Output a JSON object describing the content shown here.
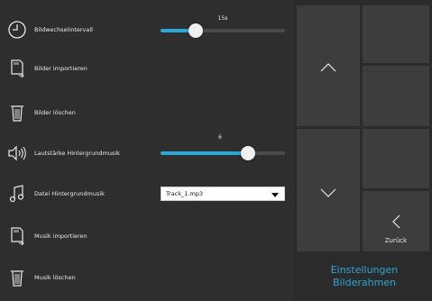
{
  "settings": {
    "slideshow_interval": {
      "label": "Bildwechselintervall",
      "value_text": "15s",
      "level": 0.28
    },
    "import_images": {
      "label": "Bilder importieren"
    },
    "delete_images": {
      "label": "Bilder löschen"
    },
    "music_volume": {
      "label": "Lautstärke Hintergrundmusik",
      "value_text": "6",
      "level": 0.7
    },
    "music_file": {
      "label": "Datei Hintergrundmusik",
      "selected": "Track_1.mp3"
    },
    "import_music": {
      "label": "Musik importieren"
    },
    "delete_music": {
      "label": "Musik löschen"
    }
  },
  "nav": {
    "back_label": "Zurück",
    "title_line1": "Einstellungen",
    "title_line2": "Bilderahmen"
  },
  "colors": {
    "accent": "#29a9d8",
    "panel": "#2e2e2e",
    "button": "#3d3d3d"
  },
  "icons": [
    "clock-icon",
    "import-card-icon",
    "trash-icon",
    "speaker-icon",
    "music-note-icon",
    "chevron-up-icon",
    "chevron-down-icon",
    "chevron-left-icon"
  ]
}
